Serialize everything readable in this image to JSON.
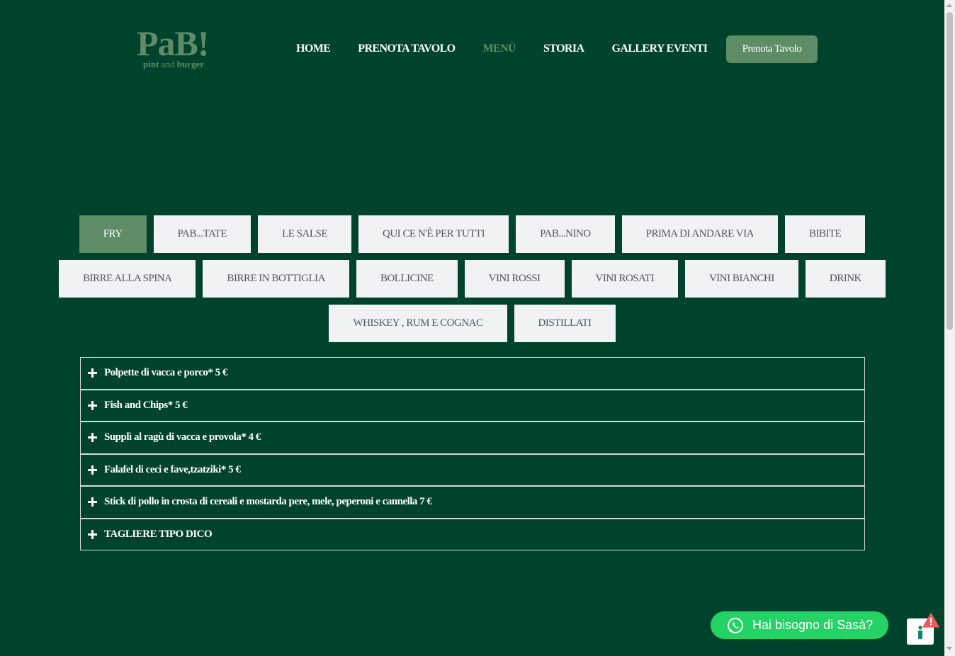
{
  "header": {
    "logo_main": "PaB!",
    "logo_sub_1": "pint",
    "logo_sub_2": "and",
    "logo_sub_3": "burger",
    "nav": [
      {
        "label": "HOME",
        "active": false
      },
      {
        "label": "PRENOTA TAVOLO",
        "active": false
      },
      {
        "label": "MENÙ",
        "active": true
      },
      {
        "label": "STORIA",
        "active": false
      },
      {
        "label": "GALLERY EVENTI",
        "active": false
      }
    ],
    "cta_label": "Prenota Tavolo"
  },
  "tabs": {
    "row1": [
      "FRY",
      "PaB...TATE",
      "LE SALSE",
      "QUI CE N'È PER TUTTI",
      "PaB...NINO",
      "PRIMA DI ANDARE VIA",
      "BIBITE"
    ],
    "row2": [
      "BIRRE ALLA SPINA",
      "BIRRE IN BOTTIGLIA",
      "BOLLICINE",
      "VINI ROSSI",
      "VINI ROSATI",
      "VINI BIANCHI",
      "DRINK"
    ],
    "row3": [
      "WHISKEY , RUM e COGNAC",
      "DISTILLATI"
    ],
    "active": "FRY"
  },
  "menu_items": [
    "Polpette di vacca e porco* 5 €",
    "Fish and Chips* 5 €",
    "Supplì al ragù di vacca e provola* 4 €",
    "Falafel di ceci e fave,tzatziki* 5 €",
    "Stick di pollo in crosta di cereali e mostarda pere, mele, peperoni e cannella 7 €",
    "TAGLIERE TIPO DICO"
  ],
  "whatsapp": {
    "label": "Hai bisogno di Sasà?",
    "color": "#24d366"
  },
  "colors": {
    "background": "#00432c",
    "accent": "#5d8c67",
    "tab_bg": "#f1f2f4"
  }
}
